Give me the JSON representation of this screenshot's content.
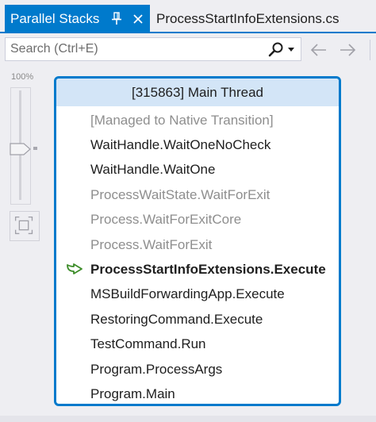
{
  "tabs": {
    "active": {
      "label": "Parallel Stacks"
    },
    "inactive": {
      "label": "ProcessStartInfoExtensions.cs"
    }
  },
  "toolbar": {
    "search_placeholder": "Search (Ctrl+E)",
    "search_value": ""
  },
  "zoom": {
    "label": "100%",
    "level_percent": 100
  },
  "stack": {
    "header": "[315863] Main Thread",
    "frames": [
      {
        "label": "[Managed to Native Transition]",
        "style": "dim"
      },
      {
        "label": "WaitHandle.WaitOneNoCheck",
        "style": "norm"
      },
      {
        "label": "WaitHandle.WaitOne",
        "style": "norm"
      },
      {
        "label": "ProcessWaitState.WaitForExit",
        "style": "dim"
      },
      {
        "label": "Process.WaitForExitCore",
        "style": "dim"
      },
      {
        "label": "Process.WaitForExit",
        "style": "dim"
      },
      {
        "label": "ProcessStartInfoExtensions.Execute",
        "style": "current"
      },
      {
        "label": "MSBuildForwardingApp.Execute",
        "style": "norm"
      },
      {
        "label": "RestoringCommand.Execute",
        "style": "norm"
      },
      {
        "label": "TestCommand.Run",
        "style": "norm"
      },
      {
        "label": "Program.ProcessArgs",
        "style": "norm"
      },
      {
        "label": "Program.Main",
        "style": "norm"
      }
    ]
  },
  "colors": {
    "accent": "#007acc",
    "header_bg": "#d3e5f7",
    "dim_text": "#8e8e8e",
    "current_arrow": "#3c8c28"
  },
  "icons": {
    "pin": "pin-icon",
    "close": "close-icon",
    "search": "search-icon",
    "back": "arrow-left-icon",
    "forward": "arrow-right-icon",
    "fit": "zoom-to-fit-icon",
    "current_frame": "current-frame-arrow-icon"
  }
}
